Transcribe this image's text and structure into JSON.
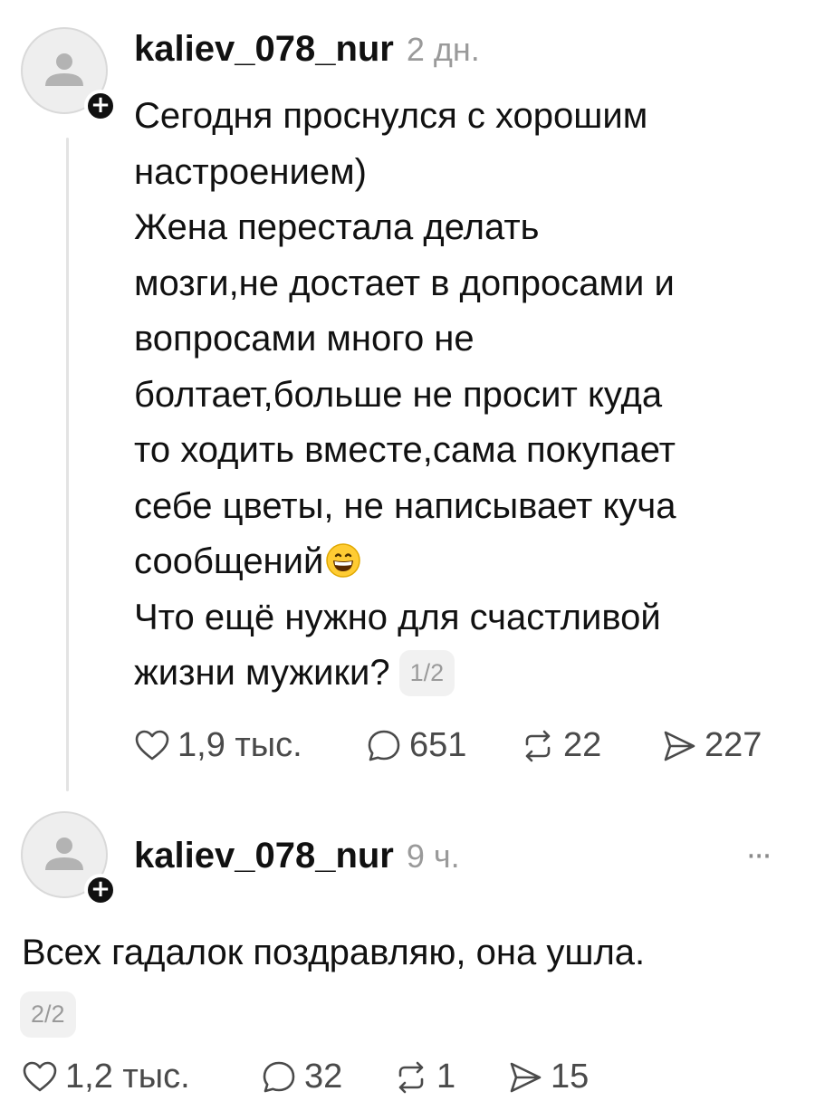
{
  "posts": [
    {
      "username": "kaliev_078_nur",
      "time": "2 дн.",
      "lines": [
        "Сегодня проснулся с хорошим",
        "настроением)",
        "Жена перестала делать",
        "мозги,не достает в допросами и",
        "вопросами много не",
        "болтает,больше не просит куда",
        "то ходить вместе,сама покупает",
        "себе цветы, не написывает куча",
        "сообщений",
        "Что ещё нужно для счастливой",
        "жизни мужики?"
      ],
      "emoji": "grinning-face-emoji",
      "page_indicator": "1/2",
      "actions": {
        "likes": "1,9 тыс.",
        "comments": "651",
        "reposts": "22",
        "shares": "227"
      }
    },
    {
      "username": "kaliev_078_nur",
      "time": "9 ч.",
      "text": "Всех гадалок поздравляю, она ушла.",
      "page_indicator": "2/2",
      "more": "···",
      "actions": {
        "likes": "1,2 тыс.",
        "comments": "32",
        "reposts": "1",
        "shares": "15"
      }
    }
  ],
  "badge_symbol": "+",
  "colors": {
    "text": "#111111",
    "muted": "#9a9a9a",
    "action": "#4a4a4a",
    "thread_line": "#e3e3e3"
  }
}
